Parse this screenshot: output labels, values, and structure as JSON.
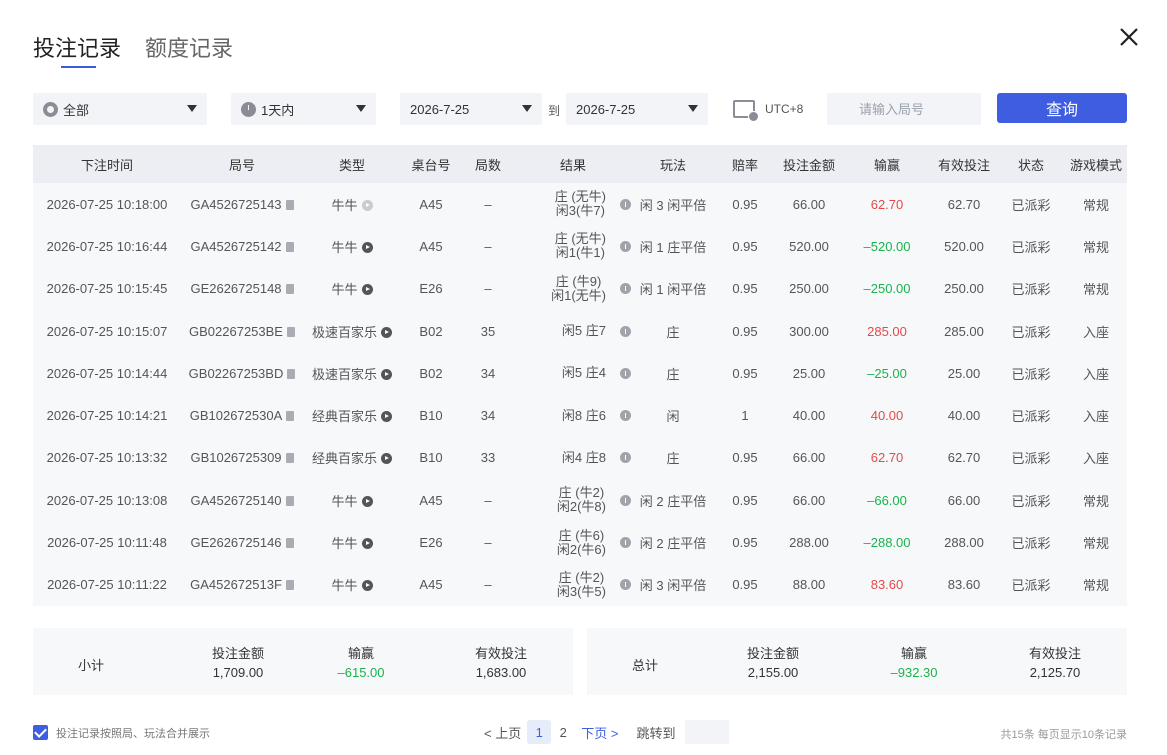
{
  "tabs": [
    {
      "label": "投注记录",
      "active": true
    },
    {
      "label": "额度记录",
      "active": false
    }
  ],
  "filters": {
    "category": "全部",
    "time_range": "1天内",
    "date_from": "2026-7-25",
    "date_to": "2026-7-25",
    "to_label": "到",
    "timezone": "UTC+8",
    "search_placeholder": "请输入局号",
    "query_label": "查询"
  },
  "table": {
    "headers": [
      "下注时间",
      "局号",
      "类型",
      "桌台号",
      "局数",
      "结果",
      "玩法",
      "赔率",
      "投注金额",
      "输赢",
      "有效投注",
      "状态",
      "游戏模式"
    ],
    "rows": [
      {
        "time": "2026-07-25 10:18:00",
        "id": "GA4526725143",
        "type": "牛牛",
        "type_icon_muted": true,
        "table": "A45",
        "round": "–",
        "result1": "庄 (无牛)",
        "result2": "闲3(牛7)",
        "play": "闲 3 闲平倍",
        "odds": "0.95",
        "bet": "66.00",
        "win": "62.70",
        "win_color": "red",
        "valid": "62.70",
        "status": "已派彩",
        "mode": "常规"
      },
      {
        "time": "2026-07-25 10:16:44",
        "id": "GA4526725142",
        "type": "牛牛",
        "type_icon_muted": false,
        "table": "A45",
        "round": "–",
        "result1": "庄 (无牛)",
        "result2": "闲1(牛1)",
        "play": "闲 1 庄平倍",
        "odds": "0.95",
        "bet": "520.00",
        "win": "–520.00",
        "win_color": "green",
        "valid": "520.00",
        "status": "已派彩",
        "mode": "常规"
      },
      {
        "time": "2026-07-25 10:15:45",
        "id": "GE2626725148",
        "type": "牛牛",
        "type_icon_muted": false,
        "table": "E26",
        "round": "–",
        "result1": "庄 (牛9)",
        "result2": "闲1(无牛)",
        "play": "闲 1 闲平倍",
        "odds": "0.95",
        "bet": "250.00",
        "win": "–250.00",
        "win_color": "green",
        "valid": "250.00",
        "status": "已派彩",
        "mode": "常规"
      },
      {
        "time": "2026-07-25 10:15:07",
        "id": "GB02267253BE",
        "type": "极速百家乐",
        "type_icon_muted": false,
        "table": "B02",
        "round": "35",
        "result1": "闲5 庄7",
        "result2": "",
        "play": "庄",
        "odds": "0.95",
        "bet": "300.00",
        "win": "285.00",
        "win_color": "red",
        "valid": "285.00",
        "status": "已派彩",
        "mode": "入座"
      },
      {
        "time": "2026-07-25 10:14:44",
        "id": "GB02267253BD",
        "type": "极速百家乐",
        "type_icon_muted": false,
        "table": "B02",
        "round": "34",
        "result1": "闲5 庄4",
        "result2": "",
        "play": "庄",
        "odds": "0.95",
        "bet": "25.00",
        "win": "–25.00",
        "win_color": "green",
        "valid": "25.00",
        "status": "已派彩",
        "mode": "入座"
      },
      {
        "time": "2026-07-25 10:14:21",
        "id": "GB102672530A",
        "type": "经典百家乐",
        "type_icon_muted": false,
        "table": "B10",
        "round": "34",
        "result1": "闲8 庄6",
        "result2": "",
        "play": "闲",
        "odds": "1",
        "bet": "40.00",
        "win": "40.00",
        "win_color": "red",
        "valid": "40.00",
        "status": "已派彩",
        "mode": "入座"
      },
      {
        "time": "2026-07-25 10:13:32",
        "id": "GB1026725309",
        "type": "经典百家乐",
        "type_icon_muted": false,
        "table": "B10",
        "round": "33",
        "result1": "闲4 庄8",
        "result2": "",
        "play": "庄",
        "odds": "0.95",
        "bet": "66.00",
        "win": "62.70",
        "win_color": "red",
        "valid": "62.70",
        "status": "已派彩",
        "mode": "入座"
      },
      {
        "time": "2026-07-25 10:13:08",
        "id": "GA4526725140",
        "type": "牛牛",
        "type_icon_muted": false,
        "table": "A45",
        "round": "–",
        "result1": "庄 (牛2)",
        "result2": "闲2(牛8)",
        "play": "闲 2 庄平倍",
        "odds": "0.95",
        "bet": "66.00",
        "win": "–66.00",
        "win_color": "green",
        "valid": "66.00",
        "status": "已派彩",
        "mode": "常规"
      },
      {
        "time": "2026-07-25 10:11:48",
        "id": "GE2626725146",
        "type": "牛牛",
        "type_icon_muted": false,
        "table": "E26",
        "round": "–",
        "result1": "庄 (牛6)",
        "result2": "闲2(牛6)",
        "play": "闲 2 庄平倍",
        "odds": "0.95",
        "bet": "288.00",
        "win": "–288.00",
        "win_color": "green",
        "valid": "288.00",
        "status": "已派彩",
        "mode": "常规"
      },
      {
        "time": "2026-07-25 10:11:22",
        "id": "GA452672513F",
        "type": "牛牛",
        "type_icon_muted": false,
        "table": "A45",
        "round": "–",
        "result1": "庄 (牛2)",
        "result2": "闲3(牛5)",
        "play": "闲 3 闲平倍",
        "odds": "0.95",
        "bet": "88.00",
        "win": "83.60",
        "win_color": "red",
        "valid": "83.60",
        "status": "已派彩",
        "mode": "常规"
      }
    ]
  },
  "subtotal": {
    "label": "小计",
    "bet_label": "投注金额",
    "bet": "1,709.00",
    "win_label": "输赢",
    "win": "–615.00",
    "valid_label": "有效投注",
    "valid": "1,683.00"
  },
  "total": {
    "label": "总计",
    "bet_label": "投注金额",
    "bet": "2,155.00",
    "win_label": "输赢",
    "win": "–932.30",
    "valid_label": "有效投注",
    "valid": "2,125.70"
  },
  "footer": {
    "merge_checked": true,
    "merge_label": "投注记录按照局、玩法合并展示",
    "prev_label": "< 上页",
    "pages": [
      "1",
      "2"
    ],
    "current_page": "1",
    "next_label": "下页 >",
    "jump_label": "跳转到",
    "total_info": "共15条   每页显示10条记录"
  },
  "colors": {
    "accent": "#3e5de0",
    "win": "#e24a4a",
    "loss": "#1ab34b"
  }
}
